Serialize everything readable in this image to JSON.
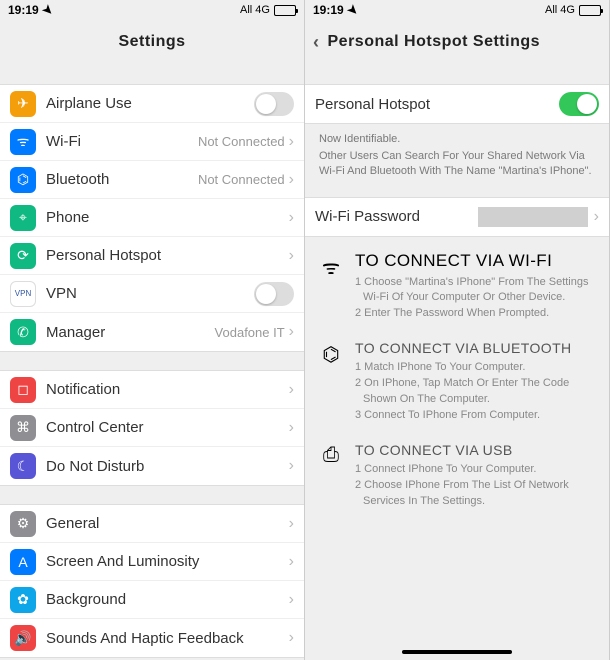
{
  "status": {
    "time": "19:19",
    "network": "All 4G"
  },
  "left": {
    "title": "Settings",
    "groups": [
      [
        {
          "icon": "airplane-icon",
          "cls": "ic-orange",
          "glyph": "✈",
          "label": "Airplane Use",
          "type": "toggle",
          "on": false
        },
        {
          "icon": "wifi-icon",
          "cls": "ic-blue",
          "glyph": "ᯤ",
          "label": "Wi-Fi",
          "detail": "Not Connected",
          "type": "chev"
        },
        {
          "icon": "bluetooth-icon",
          "cls": "ic-blue",
          "glyph": "⌬",
          "label": "Bluetooth",
          "detail": "Not Connected",
          "type": "chev"
        },
        {
          "icon": "phone-icon",
          "cls": "ic-green",
          "glyph": "⌖",
          "label": "Phone",
          "type": "chev"
        },
        {
          "icon": "hotspot-icon",
          "cls": "ic-green",
          "glyph": "⟳",
          "label": "Personal Hotspot",
          "type": "chev"
        },
        {
          "icon": "vpn-icon",
          "cls": "ic-white",
          "glyph": "VPN",
          "label": "VPN",
          "type": "toggle",
          "on": false
        },
        {
          "icon": "carrier-icon",
          "cls": "ic-green",
          "glyph": "✆",
          "label": "Manager",
          "detail": "Vodafone IT",
          "type": "chev"
        }
      ],
      [
        {
          "icon": "notification-icon",
          "cls": "ic-red",
          "glyph": "◻",
          "label": "Notification",
          "type": "chev"
        },
        {
          "icon": "control-center-icon",
          "cls": "ic-grey",
          "glyph": "⌘",
          "label": "Control Center",
          "type": "chev"
        },
        {
          "icon": "dnd-icon",
          "cls": "ic-purple",
          "glyph": "☾",
          "label": "Do Not Disturb",
          "type": "chev"
        }
      ],
      [
        {
          "icon": "general-icon",
          "cls": "ic-grey",
          "glyph": "⚙",
          "label": "General",
          "type": "chev"
        },
        {
          "icon": "display-icon",
          "cls": "ic-blue",
          "glyph": "A",
          "label": "Screen And Luminosity",
          "type": "chev"
        },
        {
          "icon": "background-icon",
          "cls": "ic-cyan",
          "glyph": "✿",
          "label": "Background",
          "type": "chev"
        },
        {
          "icon": "sounds-icon",
          "cls": "ic-red",
          "glyph": "🔊",
          "label": "Sounds And Haptic Feedback",
          "type": "chev"
        }
      ]
    ]
  },
  "right": {
    "back": "Personal Hotspot Settings",
    "toggleRow": {
      "label": "Personal Hotspot",
      "on": true
    },
    "note": {
      "title": "Now Identifiable.",
      "body": "Other Users Can Search For Your Shared Network Via Wi-Fi And Bluetooth With The Name \"Martina's IPhone\"."
    },
    "password": {
      "label": "Wi-Fi Password"
    },
    "help": [
      {
        "icon": "wifi-icon",
        "title": "TO CONNECT VIA WI-FI",
        "big": true,
        "steps": [
          "1 Choose \"Martina's IPhone\" From The Settings Wi-Fi Of Your Computer Or Other Device.",
          "2 Enter The Password When Prompted."
        ]
      },
      {
        "icon": "bluetooth-icon",
        "title": "TO CONNECT VIA BLUETOOTH",
        "steps": [
          "1 Match IPhone To Your Computer.",
          "2 On IPhone, Tap Match Or Enter The Code Shown On The Computer.",
          "3 Connect To IPhone From Computer."
        ]
      },
      {
        "icon": "usb-icon",
        "title": "TO CONNECT VIA USB",
        "steps": [
          "1 Connect IPhone To Your Computer.",
          "2 Choose IPhone From The List Of Network Services In The Settings."
        ]
      }
    ]
  }
}
